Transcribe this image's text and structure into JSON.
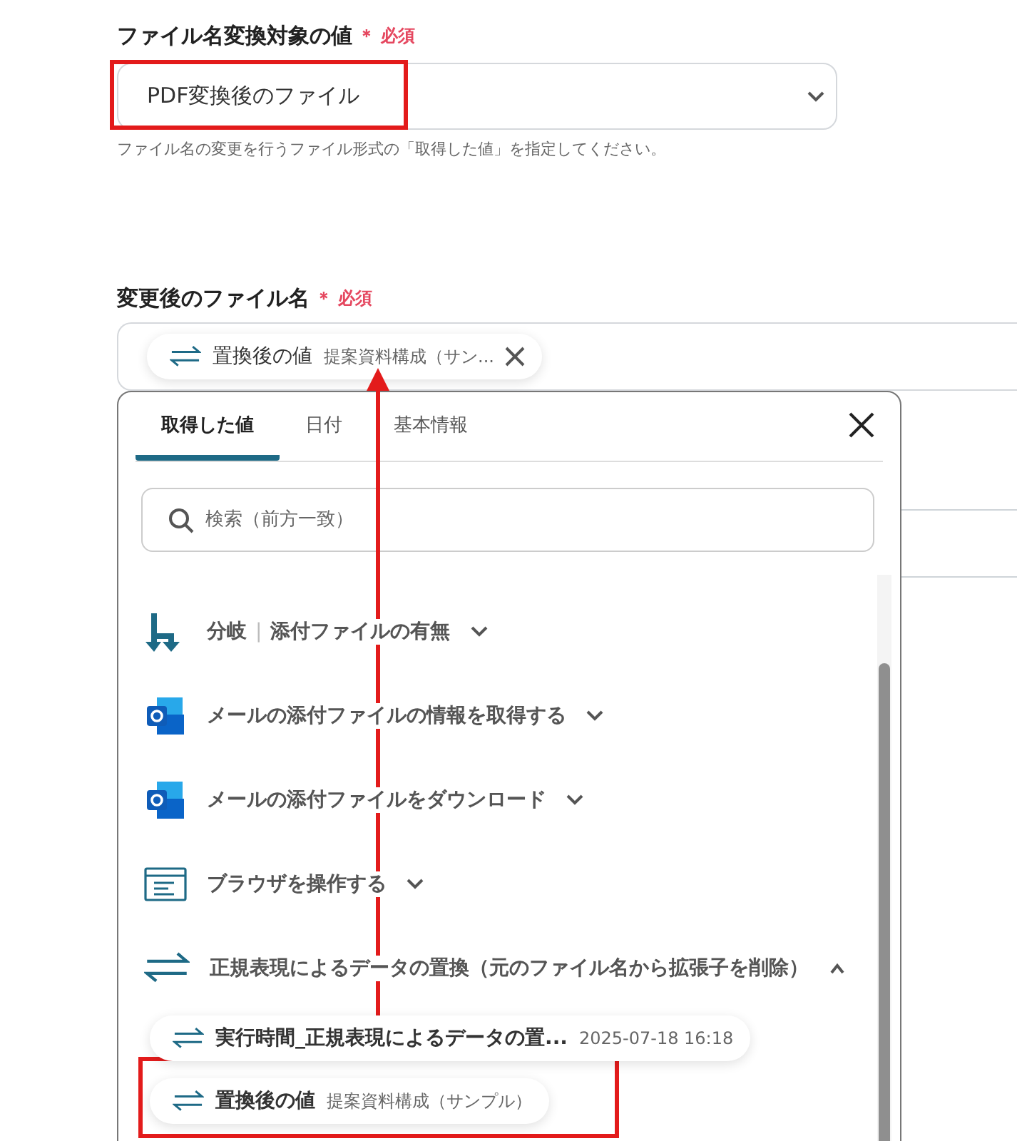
{
  "source_field": {
    "label": "ファイル名変換対象の値",
    "required_mark": "＊",
    "required": "必須",
    "value": "PDF変換後のファイル",
    "hint": "ファイル名の変更を行うファイル形式の「取得した値」を指定してください。"
  },
  "target_field": {
    "label": "変更後のファイル名",
    "required_mark": "＊",
    "required": "必須",
    "chip": {
      "name": "置換後の値",
      "value": "提案資料構成（サン..."
    }
  },
  "picker": {
    "tabs": [
      {
        "label": "取得した値",
        "selected": true
      },
      {
        "label": "日付",
        "selected": false
      },
      {
        "label": "基本情報",
        "selected": false
      }
    ],
    "search": {
      "placeholder": "検索（前方一致）"
    },
    "groups": [
      {
        "kind": "branch",
        "title": "分岐",
        "separator": "|",
        "subtitle": "添付ファイルの有無",
        "expanded": false
      },
      {
        "kind": "outlook",
        "title": "メールの添付ファイルの情報を取得する",
        "expanded": false
      },
      {
        "kind": "outlook",
        "title": "メールの添付ファイルをダウンロード",
        "expanded": false
      },
      {
        "kind": "browser",
        "title": "ブラウザを操作する",
        "expanded": false
      },
      {
        "kind": "regex",
        "title": "正規表現によるデータの置換（元のファイル名から拡張子を削除）",
        "expanded": true,
        "values": [
          {
            "name": "実行時間_正規表現によるデータの置...",
            "value": "2025-07-18 16:18"
          },
          {
            "name": "置換後の値",
            "value": "提案資料構成（サンプル）"
          }
        ]
      }
    ]
  }
}
